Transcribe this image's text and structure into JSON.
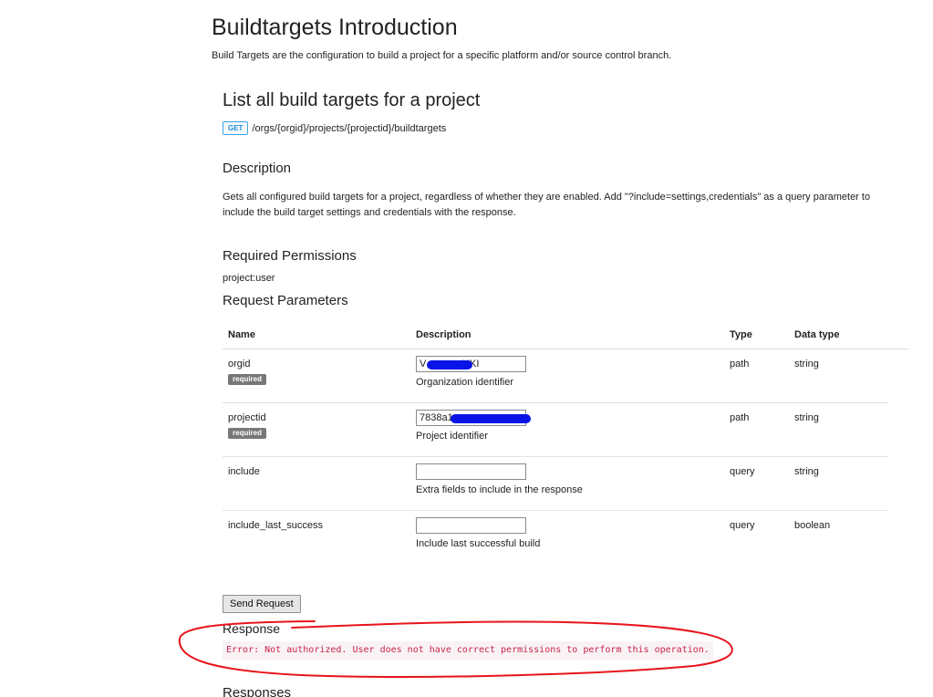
{
  "header": {
    "title": "Buildtargets Introduction",
    "subtitle": "Build Targets are the configuration to build a project for a specific platform and/or source control branch."
  },
  "endpoint": {
    "title": "List all build targets for a project",
    "method": "GET",
    "path": "/orgs/{orgid}/projects/{projectid}/buildtargets"
  },
  "description": {
    "heading": "Description",
    "text": "Gets all configured build targets for a project, regardless of whether they are enabled. Add \"?include=settings,credentials\" as a query parameter to include the build target settings and credentials with the response."
  },
  "permissions": {
    "heading": "Required Permissions",
    "value": "project:user"
  },
  "parameters": {
    "heading": "Request Parameters",
    "columns": [
      "Name",
      "Description",
      "Type",
      "Data type"
    ],
    "rows": [
      {
        "name": "orgid",
        "required": "required",
        "value": "V             HKI",
        "description": "Organization identifier",
        "type": "path",
        "data_type": "string"
      },
      {
        "name": "projectid",
        "required": "required",
        "value": "7838a1",
        "description": "Project identifier",
        "type": "path",
        "data_type": "string"
      },
      {
        "name": "include",
        "required": "",
        "value": "",
        "description": "Extra fields to include in the response",
        "type": "query",
        "data_type": "string"
      },
      {
        "name": "include_last_success",
        "required": "",
        "value": "",
        "description": "Include last successful build",
        "type": "query",
        "data_type": "boolean"
      }
    ]
  },
  "actions": {
    "send_label": "Send Request"
  },
  "response": {
    "heading": "Response",
    "text": "Error: Not authorized. User does not have correct permissions to perform this operation."
  },
  "responses": {
    "heading": "Responses"
  },
  "colors": {
    "error_text": "#c7254e",
    "annotation": "#e8141b",
    "redaction": "#0a14e6",
    "method_badge": "#1f8ad1"
  }
}
